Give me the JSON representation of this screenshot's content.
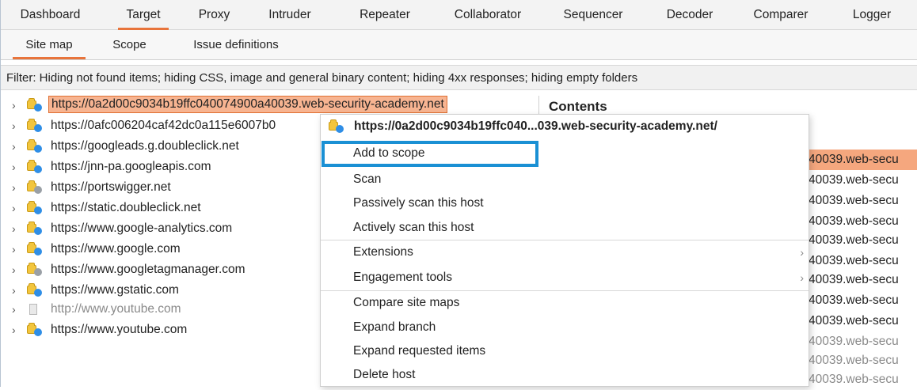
{
  "top_tabs": [
    "Dashboard",
    "Target",
    "Proxy",
    "Intruder",
    "Repeater",
    "Collaborator",
    "Sequencer",
    "Decoder",
    "Comparer",
    "Logger"
  ],
  "sub_tabs": [
    "Site map",
    "Scope",
    "Issue definitions"
  ],
  "active_top_tab": "Target",
  "active_sub_tab": "Site map",
  "filter_text": "Filter: Hiding not found items;  hiding CSS, image and general binary content;  hiding 4xx responses;  hiding empty folders",
  "tree": [
    {
      "label": "https://0a2d00c9034b19ffc040074900a40039.web-security-academy.net",
      "icon": "folder-lock-icon",
      "selected": true
    },
    {
      "label": "https://0afc006204caf42dc0a115e6007b0",
      "icon": "folder-lock-icon"
    },
    {
      "label": "https://googleads.g.doubleclick.net",
      "icon": "folder-lock-icon"
    },
    {
      "label": "https://jnn-pa.googleapis.com",
      "icon": "folder-lock-icon"
    },
    {
      "label": "https://portswigger.net",
      "icon": "folder-gray-icon"
    },
    {
      "label": "https://static.doubleclick.net",
      "icon": "folder-lock-icon"
    },
    {
      "label": "https://www.google-analytics.com",
      "icon": "folder-lock-icon"
    },
    {
      "label": "https://www.google.com",
      "icon": "folder-lock-icon"
    },
    {
      "label": "https://www.googletagmanager.com",
      "icon": "folder-gray-icon"
    },
    {
      "label": "https://www.gstatic.com",
      "icon": "folder-lock-icon"
    },
    {
      "label": "http://www.youtube.com",
      "icon": "page-icon",
      "gray": true
    },
    {
      "label": "https://www.youtube.com",
      "icon": "folder-lock-icon"
    }
  ],
  "contents": {
    "title": "Contents",
    "rows": [
      "40039.web-secu",
      "40039.web-secu",
      "40039.web-secu",
      "40039.web-secu",
      "40039.web-secu",
      "40039.web-secu",
      "40039.web-secu",
      "40039.web-secu",
      "40039.web-secu",
      "40039.web-secu",
      "40039.web-secu",
      "40039.web-secu"
    ]
  },
  "context_menu": {
    "header": "https://0a2d00c9034b19ffc040...039.web-security-academy.net/",
    "items": [
      {
        "label": "Add to scope",
        "focused": true
      },
      {
        "label": "Scan"
      },
      {
        "label": "Passively scan this host"
      },
      {
        "label": "Actively scan this host"
      },
      {
        "label": "Extensions",
        "submenu": true
      },
      {
        "label": "Engagement tools",
        "submenu": true
      },
      {
        "label": "Compare site maps"
      },
      {
        "label": "Expand branch"
      },
      {
        "label": "Expand requested items"
      },
      {
        "label": "Delete host"
      }
    ],
    "submenu_arrow": "›"
  },
  "colors": {
    "accent": "#e8743b",
    "selection": "#f7b491",
    "focus_ring": "#1a90d4"
  }
}
